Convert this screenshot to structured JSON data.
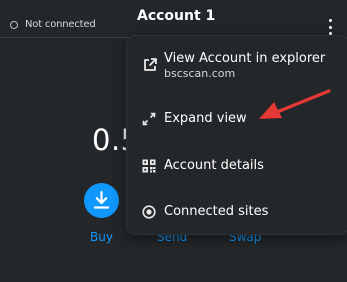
{
  "header": {
    "connection_status": "Not connected",
    "account_name": "Account 1",
    "menu_icon": "kebab-menu-icon"
  },
  "main": {
    "balance_visible": "0.5",
    "actions": [
      {
        "label": "Buy",
        "icon": "download-arrow-icon"
      },
      {
        "label": "Send"
      },
      {
        "label": "Swap"
      }
    ]
  },
  "account_menu": {
    "items": [
      {
        "label": "View Account in explorer",
        "sublabel": "bscscan.com",
        "icon": "external-link-icon"
      },
      {
        "label": "Expand view",
        "icon": "expand-icon"
      },
      {
        "label": "Account details",
        "icon": "qr-code-icon"
      },
      {
        "label": "Connected sites",
        "icon": "connected-sites-icon"
      }
    ]
  },
  "annotation": {
    "icon": "red-arrow-icon",
    "color": "#e53935"
  },
  "colors": {
    "background": "#24272a",
    "accent": "#1098fc",
    "text": "#ffffff"
  }
}
